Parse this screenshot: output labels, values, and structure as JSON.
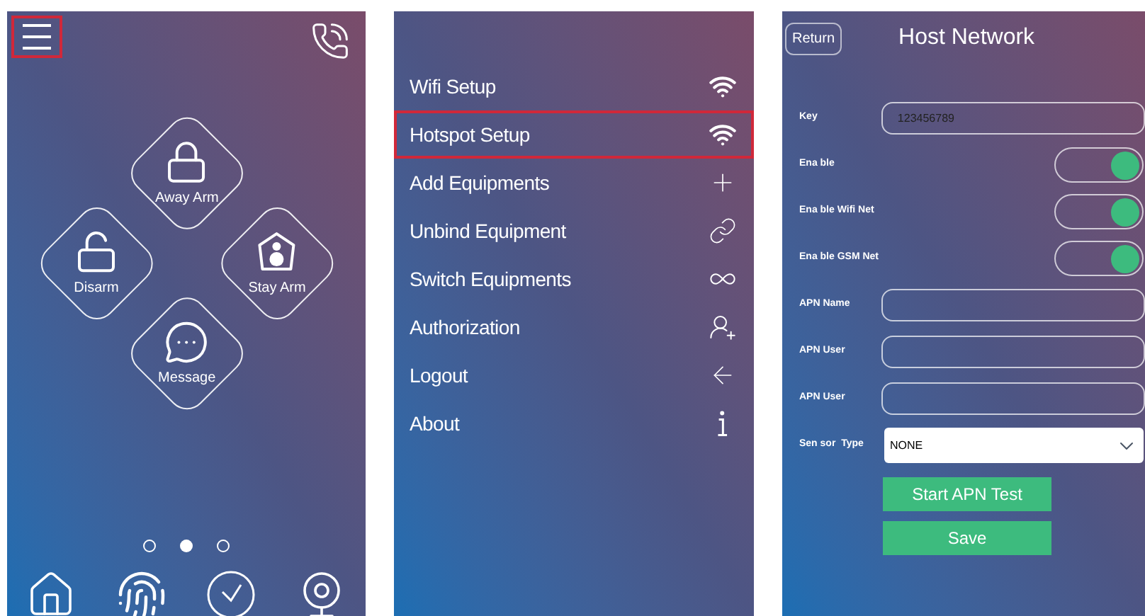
{
  "home_screen": {
    "arm_buttons": [
      {
        "kind": "away",
        "label": "Away Arm"
      },
      {
        "kind": "disarm",
        "label": "Disarm"
      },
      {
        "kind": "stay",
        "label": "Stay Arm"
      },
      {
        "kind": "message",
        "label": "Message"
      }
    ],
    "page_dots": [
      {
        "selected": false
      },
      {
        "selected": true
      },
      {
        "selected": false
      }
    ],
    "bottom_nav": [
      {
        "kind": "home"
      },
      {
        "kind": "fingerprint"
      },
      {
        "kind": "history"
      },
      {
        "kind": "camera"
      }
    ],
    "menu_highlighted": true
  },
  "menu": {
    "items": [
      {
        "label": "Wifi Setup",
        "kind": "wifi",
        "selected": false
      },
      {
        "label": "Hotspot Setup",
        "kind": "wifi",
        "selected": true
      },
      {
        "label": "Add Equipments",
        "kind": "plus",
        "selected": false
      },
      {
        "label": "Unbind Equipment",
        "kind": "link",
        "selected": false
      },
      {
        "label": "Switch Equipments",
        "kind": "infinity",
        "selected": false
      },
      {
        "label": "Authorization",
        "kind": "user-add",
        "selected": false
      },
      {
        "label": "Logout",
        "kind": "arrow",
        "selected": false
      },
      {
        "label": "About",
        "kind": "info",
        "selected": false
      }
    ]
  },
  "host_network": {
    "return_button": "Return",
    "title": "Host Network",
    "rows": [
      {
        "kind": "input",
        "label": "Key",
        "value": "123456789"
      },
      {
        "kind": "toggle",
        "label": "Ena ble",
        "on": true
      },
      {
        "kind": "toggle",
        "label": "Ena ble Wifi Net",
        "on": true
      },
      {
        "kind": "toggle",
        "label": "Ena ble GSM Net",
        "on": true
      },
      {
        "kind": "input",
        "label": "APN Name"
      },
      {
        "kind": "input",
        "label": "APN User"
      },
      {
        "kind": "input",
        "label": "APN User"
      },
      {
        "kind": "select",
        "label": "Sen sor  Type",
        "value": "NONE"
      }
    ],
    "buttons": [
      "Start APN Test",
      "Save"
    ]
  }
}
